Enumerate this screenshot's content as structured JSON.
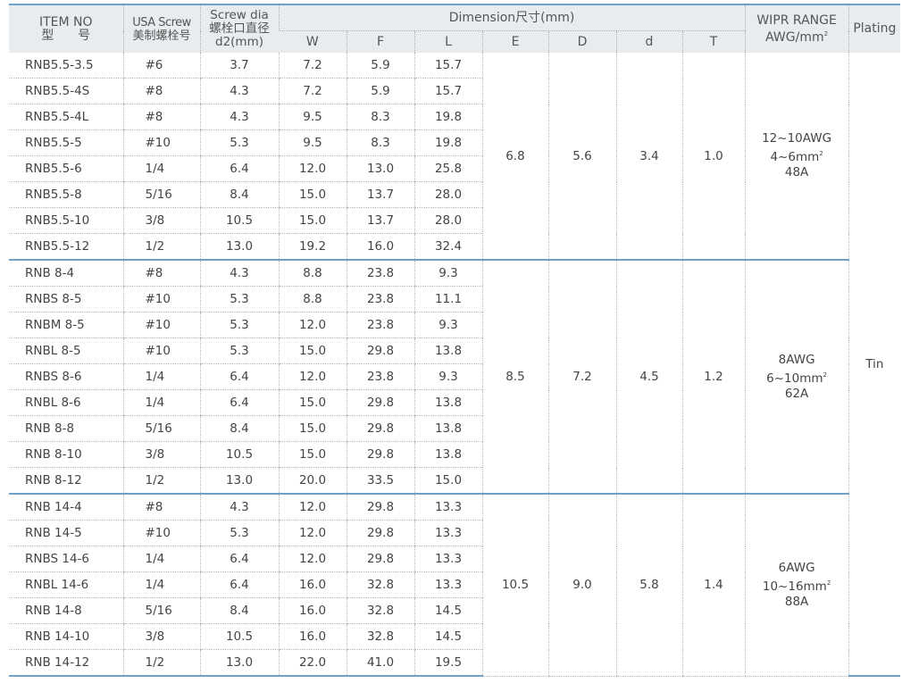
{
  "header": {
    "item_no_line1": "ITEM NO",
    "item_no_line2": "型      号",
    "usa_line1": "USA Screw",
    "usa_line2": "美制螺栓号",
    "screw_line1": "Screw dia",
    "screw_line2": "螺栓口直径",
    "screw_line3": "d2(mm)",
    "dimension": "Dimension尺寸(mm)",
    "w": "W",
    "f": "F",
    "l": "L",
    "e": "E",
    "big_d": "D",
    "small_d": "d",
    "t": "T",
    "wipr_line1": "WIPR RANGE",
    "wipr_line2": "AWG/mm",
    "wipr_sup": "2",
    "plating": "Plating"
  },
  "groups": [
    {
      "rows": [
        {
          "item": "RNB5.5-3.5",
          "usa": "#6",
          "screw": "3.7",
          "w": "7.2",
          "f": "5.9",
          "l": "15.7"
        },
        {
          "item": "RNB5.5-4S",
          "usa": "#8",
          "screw": "4.3",
          "w": "7.2",
          "f": "5.9",
          "l": "15.7"
        },
        {
          "item": "RNB5.5-4L",
          "usa": "#8",
          "screw": "4.3",
          "w": "9.5",
          "f": "8.3",
          "l": "19.8"
        },
        {
          "item": "RNB5.5-5",
          "usa": "#10",
          "screw": "5.3",
          "w": "9.5",
          "f": "8.3",
          "l": "19.8"
        },
        {
          "item": "RNB5.5-6",
          "usa": "1/4",
          "screw": "6.4",
          "w": "12.0",
          "f": "13.0",
          "l": "25.8"
        },
        {
          "item": "RNB5.5-8",
          "usa": "5/16",
          "screw": "8.4",
          "w": "15.0",
          "f": "13.7",
          "l": "28.0"
        },
        {
          "item": "RNB5.5-10",
          "usa": "3/8",
          "screw": "10.5",
          "w": "15.0",
          "f": "13.7",
          "l": "28.0"
        },
        {
          "item": "RNB5.5-12",
          "usa": "1/2",
          "screw": "13.0",
          "w": "19.2",
          "f": "16.0",
          "l": "32.4"
        }
      ],
      "e": "6.8",
      "big_d": "5.6",
      "small_d": "3.4",
      "t": "1.0",
      "wipr_awg": "12~10AWG",
      "wipr_mm": "4~6mm",
      "wipr_sup": "2",
      "wipr_amp": "48A"
    },
    {
      "rows": [
        {
          "item": "RNB 8-4",
          "usa": "#8",
          "screw": "4.3",
          "w": "8.8",
          "f": "23.8",
          "l": "9.3"
        },
        {
          "item": "RNBS 8-5",
          "usa": "#10",
          "screw": "5.3",
          "w": "8.8",
          "f": "23.8",
          "l": "11.1"
        },
        {
          "item": "RNBM 8-5",
          "usa": "#10",
          "screw": "5.3",
          "w": "12.0",
          "f": "23.8",
          "l": "9.3"
        },
        {
          "item": "RNBL 8-5",
          "usa": "#10",
          "screw": "5.3",
          "w": "15.0",
          "f": "29.8",
          "l": "13.8"
        },
        {
          "item": "RNBS 8-6",
          "usa": "1/4",
          "screw": "6.4",
          "w": "12.0",
          "f": "23.8",
          "l": "9.3"
        },
        {
          "item": "RNBL 8-6",
          "usa": "1/4",
          "screw": "6.4",
          "w": "15.0",
          "f": "29.8",
          "l": "13.8"
        },
        {
          "item": "RNB 8-8",
          "usa": "5/16",
          "screw": "8.4",
          "w": "15.0",
          "f": "29.8",
          "l": "13.8"
        },
        {
          "item": "RNB 8-10",
          "usa": "3/8",
          "screw": "10.5",
          "w": "15.0",
          "f": "29.8",
          "l": "13.8"
        },
        {
          "item": "RNB 8-12",
          "usa": "1/2",
          "screw": "13.0",
          "w": "20.0",
          "f": "33.5",
          "l": "15.0"
        }
      ],
      "e": "8.5",
      "big_d": "7.2",
      "small_d": "4.5",
      "t": "1.2",
      "wipr_awg": "8AWG",
      "wipr_mm": "6~10mm",
      "wipr_sup": "2",
      "wipr_amp": "62A"
    },
    {
      "rows": [
        {
          "item": "RNB 14-4",
          "usa": "#8",
          "screw": "4.3",
          "w": "12.0",
          "f": "29.8",
          "l": "13.3"
        },
        {
          "item": "RNB 14-5",
          "usa": "#10",
          "screw": "5.3",
          "w": "12.0",
          "f": "29.8",
          "l": "13.3"
        },
        {
          "item": "RNBS 14-6",
          "usa": "1/4",
          "screw": "6.4",
          "w": "12.0",
          "f": "29.8",
          "l": "13.3"
        },
        {
          "item": "RNBL 14-6",
          "usa": "1/4",
          "screw": "6.4",
          "w": "16.0",
          "f": "32.8",
          "l": "13.3"
        },
        {
          "item": "RNB 14-8",
          "usa": "5/16",
          "screw": "8.4",
          "w": "16.0",
          "f": "32.8",
          "l": "14.5"
        },
        {
          "item": "RNB 14-10",
          "usa": "3/8",
          "screw": "10.5",
          "w": "16.0",
          "f": "32.8",
          "l": "14.5"
        },
        {
          "item": "RNB 14-12",
          "usa": "1/2",
          "screw": "13.0",
          "w": "22.0",
          "f": "41.0",
          "l": "19.5"
        }
      ],
      "e": "10.5",
      "big_d": "9.0",
      "small_d": "5.8",
      "t": "1.4",
      "wipr_awg": "6AWG",
      "wipr_mm": "10~16mm",
      "wipr_sup": "2",
      "wipr_amp": "88A"
    }
  ],
  "plating": "Tin"
}
